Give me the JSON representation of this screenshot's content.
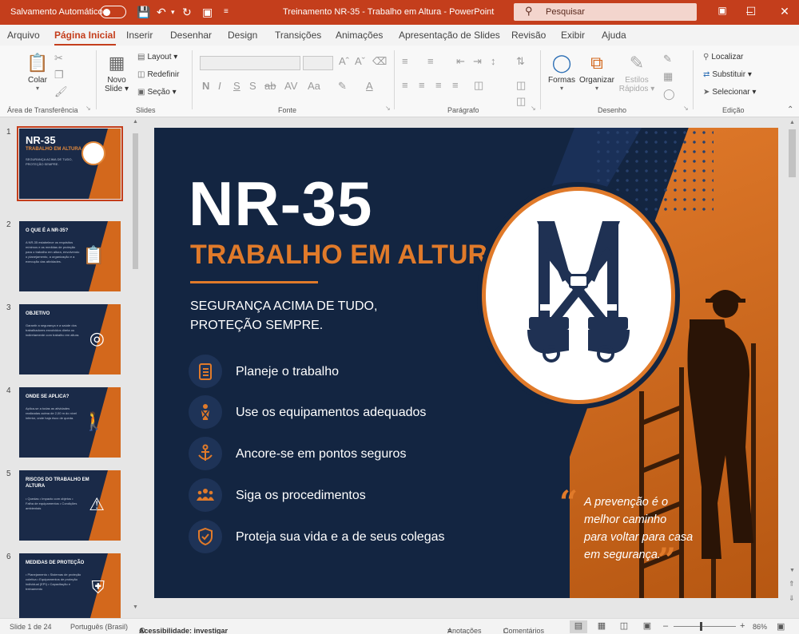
{
  "titlebar": {
    "autosave_label": "Salvamento Automático",
    "doc_title": "Treinamento NR-35 - Trabalho em Altura - PowerPoint",
    "search_placeholder": "Pesquisar",
    "accent": "#c43e1c"
  },
  "tabs": [
    "Arquivo",
    "Página Inicial",
    "Inserir",
    "Desenhar",
    "Design",
    "Transições",
    "Animações",
    "Apresentação de Slides",
    "Revisão",
    "Exibir",
    "Ajuda"
  ],
  "active_tab": "Página Inicial",
  "ribbon": {
    "clipboard": {
      "paste": "Colar",
      "group": "Área de Transferência"
    },
    "slides": {
      "new_slide_1": "Novo",
      "new_slide_2": "Slide",
      "layout": "Layout",
      "reset": "Redefinir",
      "section": "Seção",
      "group": "Slides"
    },
    "font": {
      "group": "Fonte"
    },
    "paragraph": {
      "group": "Parágrafo"
    },
    "drawing": {
      "shapes": "Formas",
      "arrange": "Organizar",
      "styles_1": "Estilos",
      "styles_2": "Rápidos",
      "group": "Desenho"
    },
    "editing": {
      "find": "Localizar",
      "replace": "Substituir",
      "select": "Selecionar",
      "group": "Edição"
    }
  },
  "thumbnails": [
    {
      "num": "1",
      "title": "NR-35",
      "subtitle": "TRABALHO EM ALTURA",
      "body": "SEGURANÇA ACIMA DE TUDO, PROTEÇÃO SEMPRE.",
      "selected": true
    },
    {
      "num": "2",
      "title": "O QUE É A NR-35?",
      "body": "A NR-35 estabelece os requisitos mínimos e as medidas de proteção para o trabalho em altura, envolvendo o planejamento, a organização e a execução das atividades.",
      "icon": "clipboard-icon"
    },
    {
      "num": "3",
      "title": "OBJETIVO",
      "body": "Garantir a segurança e a saúde dos trabalhadores envolvidos direta ou indiretamente com trabalho em altura.",
      "icon": "target-icon"
    },
    {
      "num": "4",
      "title": "ONDE SE APLICA?",
      "body": "Aplica-se a todas as atividades realizadas acima de 2,00 m do nível inferior, onde haja risco de queda.",
      "icon": "climber-icon"
    },
    {
      "num": "5",
      "title": "RISCOS DO TRABALHO EM ALTURA",
      "body": "• Quedas • Impacto com objetos • Falha de equipamentos • Condições ambientais",
      "icon": "warning-icon"
    },
    {
      "num": "6",
      "title": "MEDIDAS DE PROTEÇÃO",
      "body": "• Planejamento • Sistemas de proteção coletiva • Equipamentos de proteção individual (EPI) • Capacitação e treinamento",
      "icon": "shield-icon"
    }
  ],
  "slide": {
    "title": "NR-35",
    "subtitle": "TRABALHO EM ALTURA",
    "tagline_1": "SEGURANÇA ACIMA DE TUDO,",
    "tagline_2": "PROTEÇÃO SEMPRE.",
    "items": [
      {
        "label": "Planeje o trabalho",
        "icon": "checklist-icon"
      },
      {
        "label": "Use os equipamentos adequados",
        "icon": "harness-person-icon"
      },
      {
        "label": "Ancore-se em pontos seguros",
        "icon": "anchor-icon"
      },
      {
        "label": "Siga os procedimentos",
        "icon": "team-icon"
      },
      {
        "label": "Proteja sua vida e a de seus colegas",
        "icon": "shield-check-icon"
      }
    ],
    "quote_1": "A prevenção é o",
    "quote_2": "melhor caminho",
    "quote_3": "para voltar para casa",
    "quote_4": "em segurança.",
    "colors": {
      "navy": "#132541",
      "orange": "#e07a2a"
    }
  },
  "status": {
    "slide_count": "Slide 1 de 24",
    "language": "Português (Brasil)",
    "accessibility": "Acessibilidade: investigar",
    "notes": "Anotações",
    "comments": "Comentários",
    "zoom": "86%"
  }
}
